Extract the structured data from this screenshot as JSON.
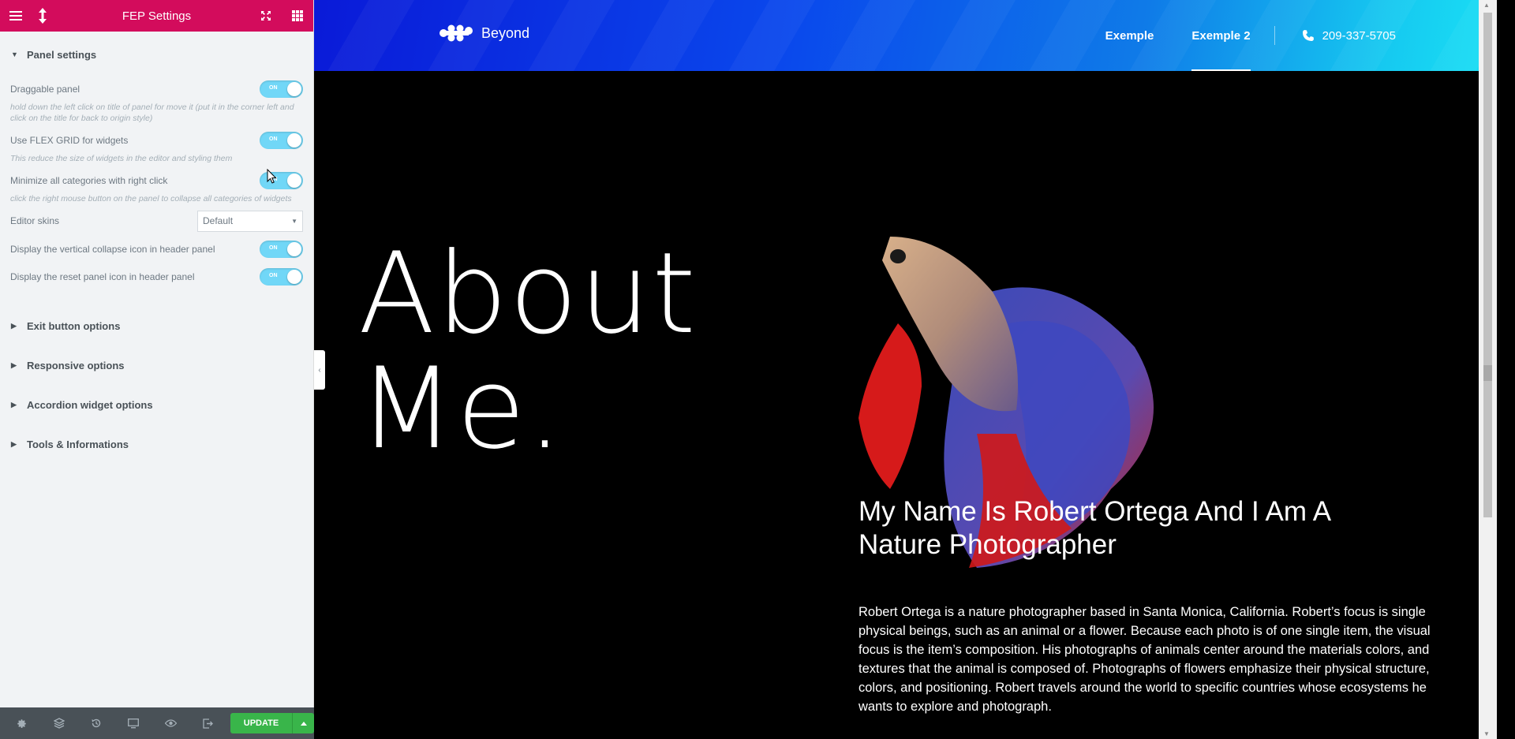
{
  "panel": {
    "title": "FEP Settings",
    "sections": {
      "panel_settings": "Panel settings",
      "exit": "Exit button options",
      "responsive": "Responsive options",
      "accordion": "Accordion widget options",
      "tools": "Tools & Informations"
    },
    "controls": {
      "draggable": {
        "label": "Draggable panel",
        "toggle": "ON",
        "desc": "hold down the left click on title of panel for move it (put it in the corner left and click on the title for back to origin style)"
      },
      "flex": {
        "label": "Use FLEX GRID for widgets",
        "toggle": "ON",
        "desc": "This reduce the size of widgets in the editor and styling them"
      },
      "minimize": {
        "label": "Minimize all categories with right click",
        "toggle": "ON",
        "desc": "click the right mouse button on the panel to collapse all categories of widgets"
      },
      "skins": {
        "label": "Editor skins",
        "value": "Default"
      },
      "collapse_icon": {
        "label": "Display the vertical collapse icon in header panel",
        "toggle": "ON"
      },
      "reset_icon": {
        "label": "Display the reset panel icon in header panel",
        "toggle": "ON"
      }
    },
    "footer": {
      "update_label": "UPDATE"
    }
  },
  "site": {
    "logo_text": "Beyond",
    "nav": [
      "Exemple",
      "Exemple 2"
    ],
    "phone": "209-337-5705",
    "about_line1": "About",
    "about_line2": "Me.",
    "headline": "My Name Is Robert Ortega And I Am A Nature Photographer",
    "bio": "Robert Ortega is a nature photographer based in Santa Monica, California. Robert’s focus is single physical beings, such as an animal or a flower. Because each photo is of one single item, the visual focus is the item’s composition. His photographs of animals center around the materials colors, and textures that the animal is composed of. Photographs of flowers emphasize their physical structure, colors, and positioning. Robert travels around the world to specific countries whose ecosystems he wants to explore and photograph."
  },
  "colors": {
    "panel_header": "#d30c5c",
    "toggle_on": "#71d7f7",
    "update_button": "#39b54a",
    "footer": "#495157"
  }
}
